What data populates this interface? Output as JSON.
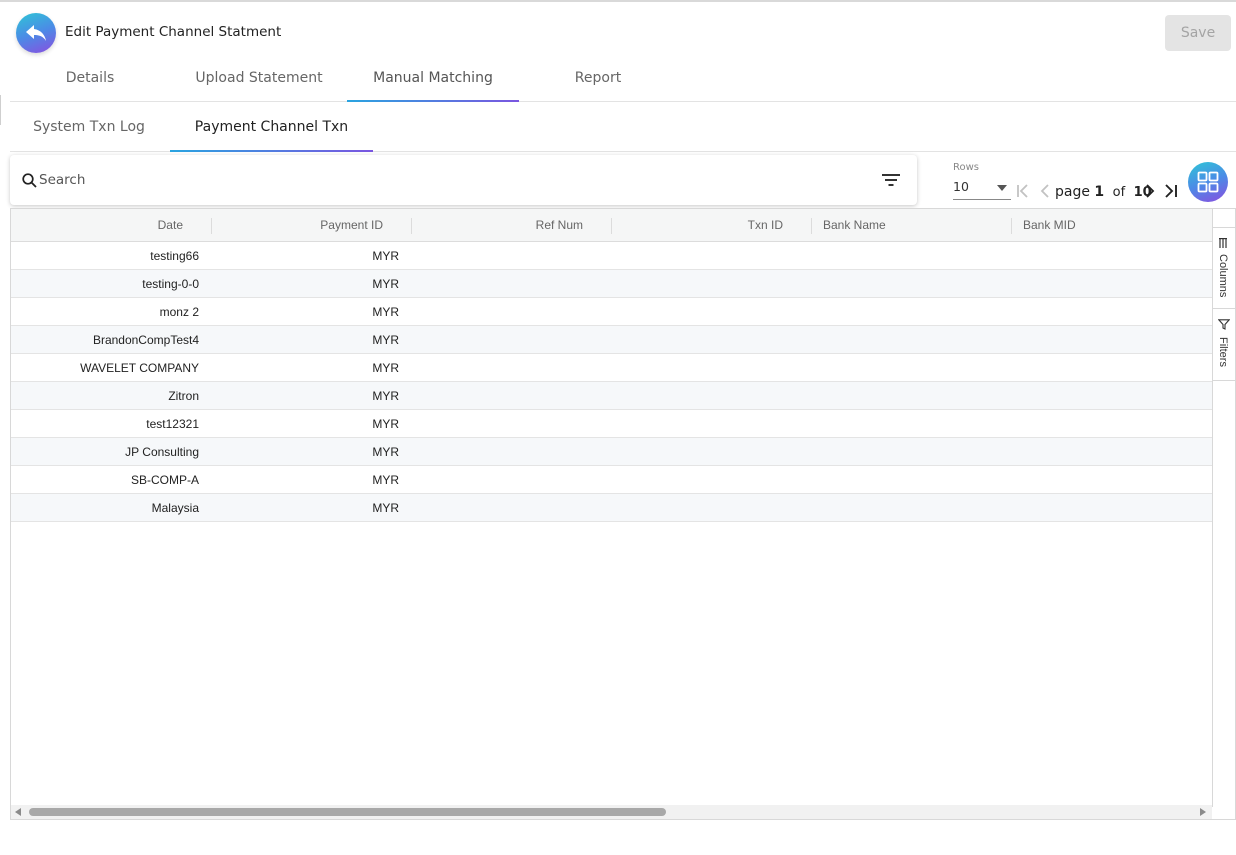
{
  "header": {
    "title": "Edit Payment Channel Statment",
    "save_label": "Save"
  },
  "main_tabs": [
    {
      "label": "Details"
    },
    {
      "label": "Upload Statement"
    },
    {
      "label": "Manual Matching",
      "active": true
    },
    {
      "label": "Report"
    }
  ],
  "sub_tabs": [
    {
      "label": "System Txn Log"
    },
    {
      "label": "Payment Channel Txn",
      "active": true
    }
  ],
  "search": {
    "placeholder": "Search",
    "value": ""
  },
  "pagination": {
    "rows_label": "Rows",
    "rows_value": "10",
    "page_word": "page",
    "current_page": "1",
    "of_word": "of",
    "total_pages": "10"
  },
  "grid": {
    "columns": [
      "Date",
      "Payment ID",
      "Ref Num",
      "Txn ID",
      "Bank Name",
      "Bank MID"
    ],
    "rows": [
      {
        "date": "testing66",
        "payment_id": "MYR"
      },
      {
        "date": "testing-0-0",
        "payment_id": "MYR"
      },
      {
        "date": "monz 2",
        "payment_id": "MYR"
      },
      {
        "date": "BrandonCompTest4",
        "payment_id": "MYR"
      },
      {
        "date": "WAVELET COMPANY",
        "payment_id": "MYR"
      },
      {
        "date": "Zitron",
        "payment_id": "MYR"
      },
      {
        "date": "test12321",
        "payment_id": "MYR"
      },
      {
        "date": "JP Consulting",
        "payment_id": "MYR"
      },
      {
        "date": "SB-COMP-A",
        "payment_id": "MYR"
      },
      {
        "date": "Malaysia",
        "payment_id": "MYR"
      }
    ]
  },
  "side_panel": {
    "columns_label": "Columns",
    "filters_label": "Filters"
  },
  "colors": {
    "accent_gradient_start": "#2ec6d6",
    "accent_gradient_end": "#8a4ee0",
    "tab_underline": "#2aa4e0",
    "save_disabled_bg": "#e4e4e4"
  },
  "icons": {
    "back": "back-arrow-icon",
    "search": "search-icon",
    "filter": "filter-lines-icon",
    "first": "first-page-icon",
    "prev": "prev-page-icon",
    "next": "next-page-icon",
    "last": "last-page-icon",
    "grid": "grid-view-icon",
    "columns": "columns-icon",
    "filters": "funnel-icon"
  }
}
